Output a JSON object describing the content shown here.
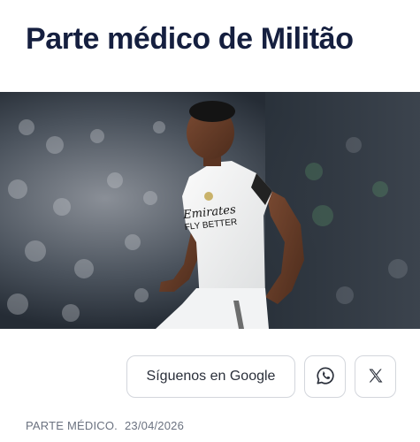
{
  "article": {
    "title": "Parte médico de Militão",
    "category": "PARTE MÉDICO.",
    "date": "23/04/2026"
  },
  "hero": {
    "jersey_sponsor_line1": "Emirates",
    "jersey_sponsor_line2": "FLY BETTER",
    "icon": "football-player-photo"
  },
  "share": {
    "google_label": "Síguenos en Google",
    "whatsapp_icon": "whatsapp-icon",
    "x_icon": "x-icon"
  },
  "colors": {
    "title": "#151f3f",
    "meta": "#6b7280",
    "border": "#d3d6dc"
  }
}
